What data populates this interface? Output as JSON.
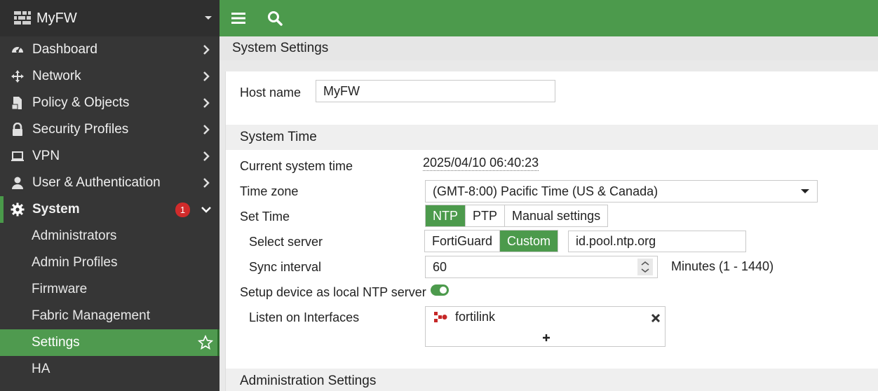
{
  "sidebar": {
    "brand": "MyFW",
    "items": [
      {
        "label": "Dashboard",
        "icon": "dashboard-icon"
      },
      {
        "label": "Network",
        "icon": "network-icon"
      },
      {
        "label": "Policy & Objects",
        "icon": "policy-icon"
      },
      {
        "label": "Security Profiles",
        "icon": "lock-icon"
      },
      {
        "label": "VPN",
        "icon": "laptop-icon"
      },
      {
        "label": "User & Authentication",
        "icon": "user-icon"
      },
      {
        "label": "System",
        "icon": "gear-icon",
        "badge": "1"
      }
    ],
    "system_sub": [
      {
        "label": "Administrators"
      },
      {
        "label": "Admin Profiles"
      },
      {
        "label": "Firmware"
      },
      {
        "label": "Fabric Management"
      },
      {
        "label": "Settings"
      },
      {
        "label": "HA"
      }
    ]
  },
  "page": {
    "title": "System Settings"
  },
  "form": {
    "host_name_label": "Host name",
    "host_name_value": "MyFW",
    "system_time_head": "System Time",
    "current_time_label": "Current system time",
    "current_time_value": "2025/04/10 06:40:23",
    "time_zone_label": "Time zone",
    "time_zone_value": "(GMT-8:00) Pacific Time (US & Canada)",
    "set_time_label": "Set Time",
    "set_time_options": [
      "NTP",
      "PTP",
      "Manual settings"
    ],
    "select_server_label": "Select server",
    "server_options": [
      "FortiGuard",
      "Custom"
    ],
    "server_value": "id.pool.ntp.org",
    "sync_interval_label": "Sync interval",
    "sync_interval_value": "60",
    "sync_interval_unit": "Minutes (1 - 1440)",
    "local_ntp_label": "Setup device as local NTP server",
    "listen_label": "Listen on Interfaces",
    "listen_interface": "fortilink",
    "admin_settings_head": "Administration Settings"
  },
  "colors": {
    "accent": "#4c9a4c",
    "sidebar_bg": "#363636",
    "badge": "#d12b2b"
  }
}
